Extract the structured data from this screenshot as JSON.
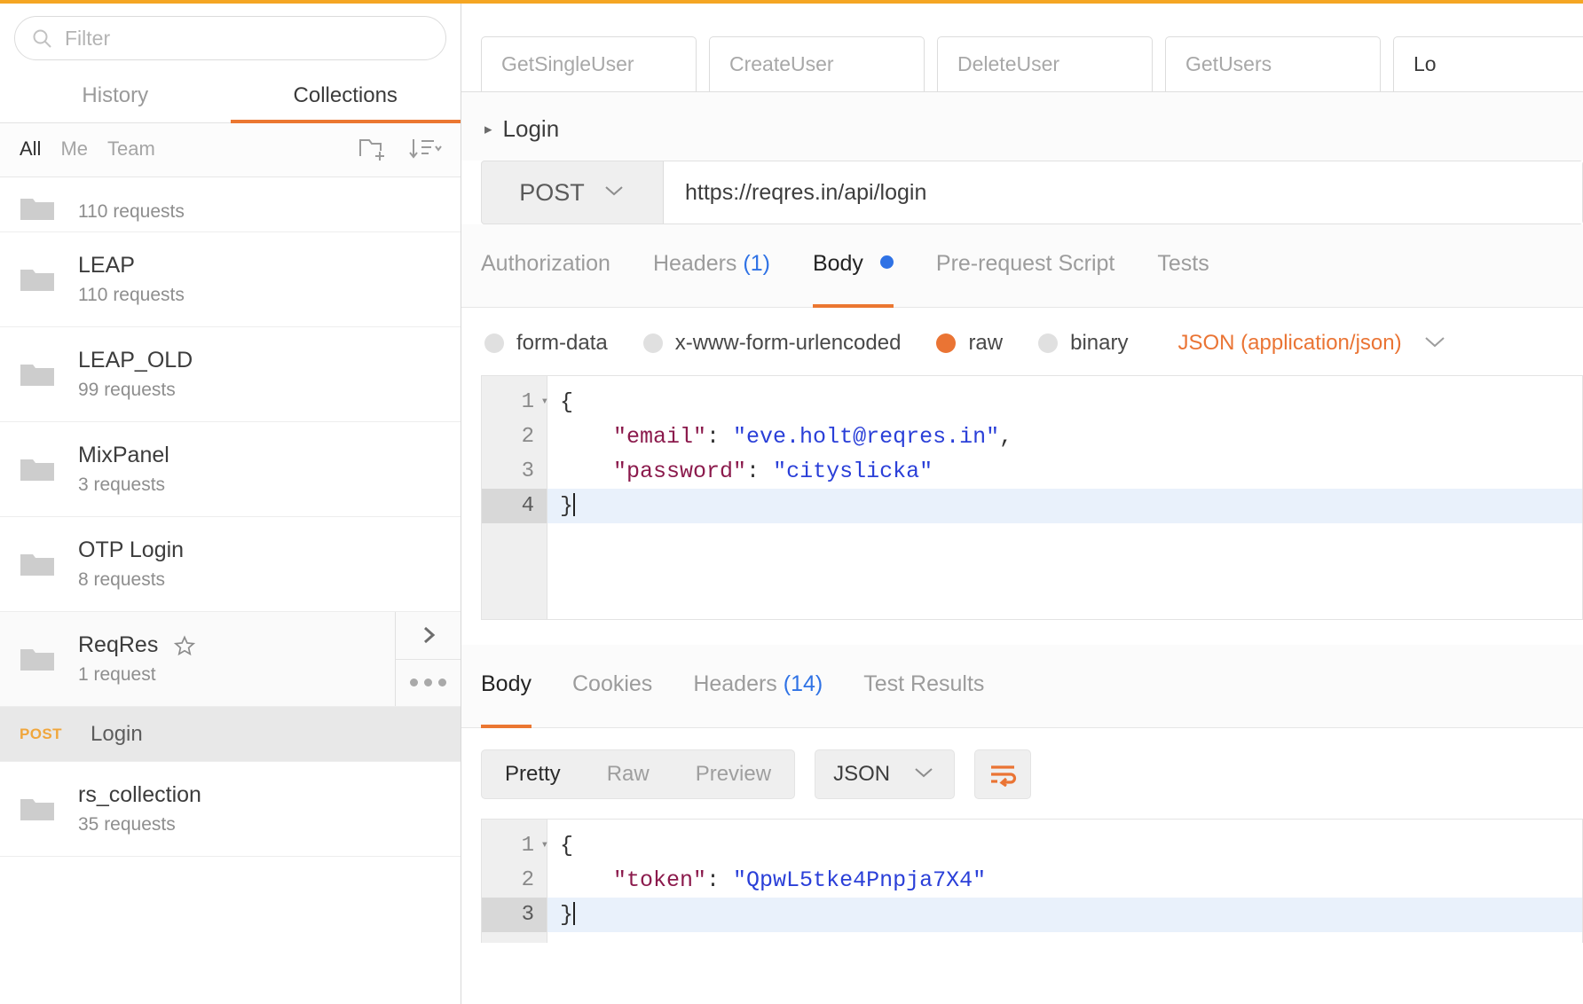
{
  "theme": {
    "accent": "#eb7731",
    "accent_top": "#f5a623",
    "link_blue": "#2f72e5",
    "method_post": "#f0a63c"
  },
  "sidebar": {
    "filter": {
      "placeholder": "Filter",
      "value": "",
      "icon": "search-icon"
    },
    "tabs": [
      {
        "label": "History",
        "active": false
      },
      {
        "label": "Collections",
        "active": true
      }
    ],
    "scopes": [
      {
        "label": "All",
        "active": true
      },
      {
        "label": "Me",
        "active": false
      },
      {
        "label": "Team",
        "active": false
      }
    ],
    "actions": [
      {
        "icon": "new-folder-icon",
        "label": "New Folder"
      },
      {
        "icon": "sort-icon",
        "label": "Sort"
      }
    ],
    "collections": [
      {
        "name": "",
        "count": "110 requests",
        "partial": true,
        "starred": false,
        "hover": false
      },
      {
        "name": "LEAP",
        "count": "110 requests",
        "partial": false,
        "starred": false,
        "hover": false
      },
      {
        "name": "LEAP_OLD",
        "count": "99 requests",
        "partial": false,
        "starred": false,
        "hover": false
      },
      {
        "name": "MixPanel",
        "count": "3 requests",
        "partial": false,
        "starred": false,
        "hover": false
      },
      {
        "name": "OTP Login",
        "count": "8 requests",
        "partial": false,
        "starred": false,
        "hover": false
      },
      {
        "name": "ReqRes",
        "count": "1 request",
        "partial": false,
        "starred": true,
        "hover": true
      }
    ],
    "selected_request": {
      "method": "POST",
      "name": "Login"
    },
    "collections_after": [
      {
        "name": "rs_collection",
        "count": "35 requests"
      }
    ],
    "row_actions": [
      {
        "icon": "chevron-right-icon",
        "label": "Expand"
      },
      {
        "icon": "ellipsis-icon",
        "label": "More actions"
      }
    ]
  },
  "request_tabs": [
    {
      "label": "GetSingleUser",
      "active": false
    },
    {
      "label": "CreateUser",
      "active": false
    },
    {
      "label": "DeleteUser",
      "active": false
    },
    {
      "label": "GetUsers",
      "active": false
    },
    {
      "label": "Lo",
      "active": true
    }
  ],
  "breadcrumb": {
    "caret": "▸",
    "title": "Login"
  },
  "url_bar": {
    "method": "POST",
    "url": "https://reqres.in/api/login"
  },
  "request_inner_tabs": [
    {
      "label": "Authorization",
      "count": "",
      "active": false,
      "dot": false
    },
    {
      "label": "Headers",
      "count": "(1)",
      "active": false,
      "dot": false
    },
    {
      "label": "Body",
      "count": "",
      "active": true,
      "dot": true
    },
    {
      "label": "Pre-request Script",
      "count": "",
      "active": false,
      "dot": false
    },
    {
      "label": "Tests",
      "count": "",
      "active": false,
      "dot": false
    }
  ],
  "body_types": [
    {
      "label": "form-data",
      "selected": false
    },
    {
      "label": "x-www-form-urlencoded",
      "selected": false
    },
    {
      "label": "raw",
      "selected": true
    },
    {
      "label": "binary",
      "selected": false
    }
  ],
  "mime": {
    "label": "JSON (application/json)"
  },
  "request_body": {
    "lines": [
      {
        "n": "1",
        "fold": true,
        "current": false,
        "tokens": [
          {
            "t": "{",
            "c": "p"
          }
        ]
      },
      {
        "n": "2",
        "fold": false,
        "current": false,
        "tokens": [
          {
            "t": "    \"email\"",
            "c": "k"
          },
          {
            "t": ": ",
            "c": "p"
          },
          {
            "t": "\"eve.holt@reqres.in\"",
            "c": "v"
          },
          {
            "t": ",",
            "c": "p"
          }
        ]
      },
      {
        "n": "3",
        "fold": false,
        "current": false,
        "tokens": [
          {
            "t": "    \"password\"",
            "c": "k"
          },
          {
            "t": ": ",
            "c": "p"
          },
          {
            "t": "\"cityslicka\"",
            "c": "v"
          }
        ]
      },
      {
        "n": "4",
        "fold": false,
        "current": true,
        "tokens": [
          {
            "t": "}",
            "c": "p"
          }
        ]
      }
    ]
  },
  "response_tabs": [
    {
      "label": "Body",
      "count": "",
      "active": true
    },
    {
      "label": "Cookies",
      "count": "",
      "active": false
    },
    {
      "label": "Headers",
      "count": "(14)",
      "active": false
    },
    {
      "label": "Test Results",
      "count": "",
      "active": false
    }
  ],
  "response_toolbar": {
    "views": [
      {
        "label": "Pretty",
        "active": true
      },
      {
        "label": "Raw",
        "active": false
      },
      {
        "label": "Preview",
        "active": false
      }
    ],
    "format": "JSON",
    "wrap_icon": "word-wrap-icon"
  },
  "response_body": {
    "lines": [
      {
        "n": "1",
        "fold": true,
        "current": false,
        "tokens": [
          {
            "t": "{",
            "c": "p"
          }
        ]
      },
      {
        "n": "2",
        "fold": false,
        "current": false,
        "tokens": [
          {
            "t": "    \"token\"",
            "c": "k"
          },
          {
            "t": ": ",
            "c": "p"
          },
          {
            "t": "\"QpwL5tke4Pnpja7X4\"",
            "c": "v"
          }
        ]
      },
      {
        "n": "3",
        "fold": false,
        "current": true,
        "tokens": [
          {
            "t": "}",
            "c": "p"
          }
        ]
      }
    ]
  }
}
